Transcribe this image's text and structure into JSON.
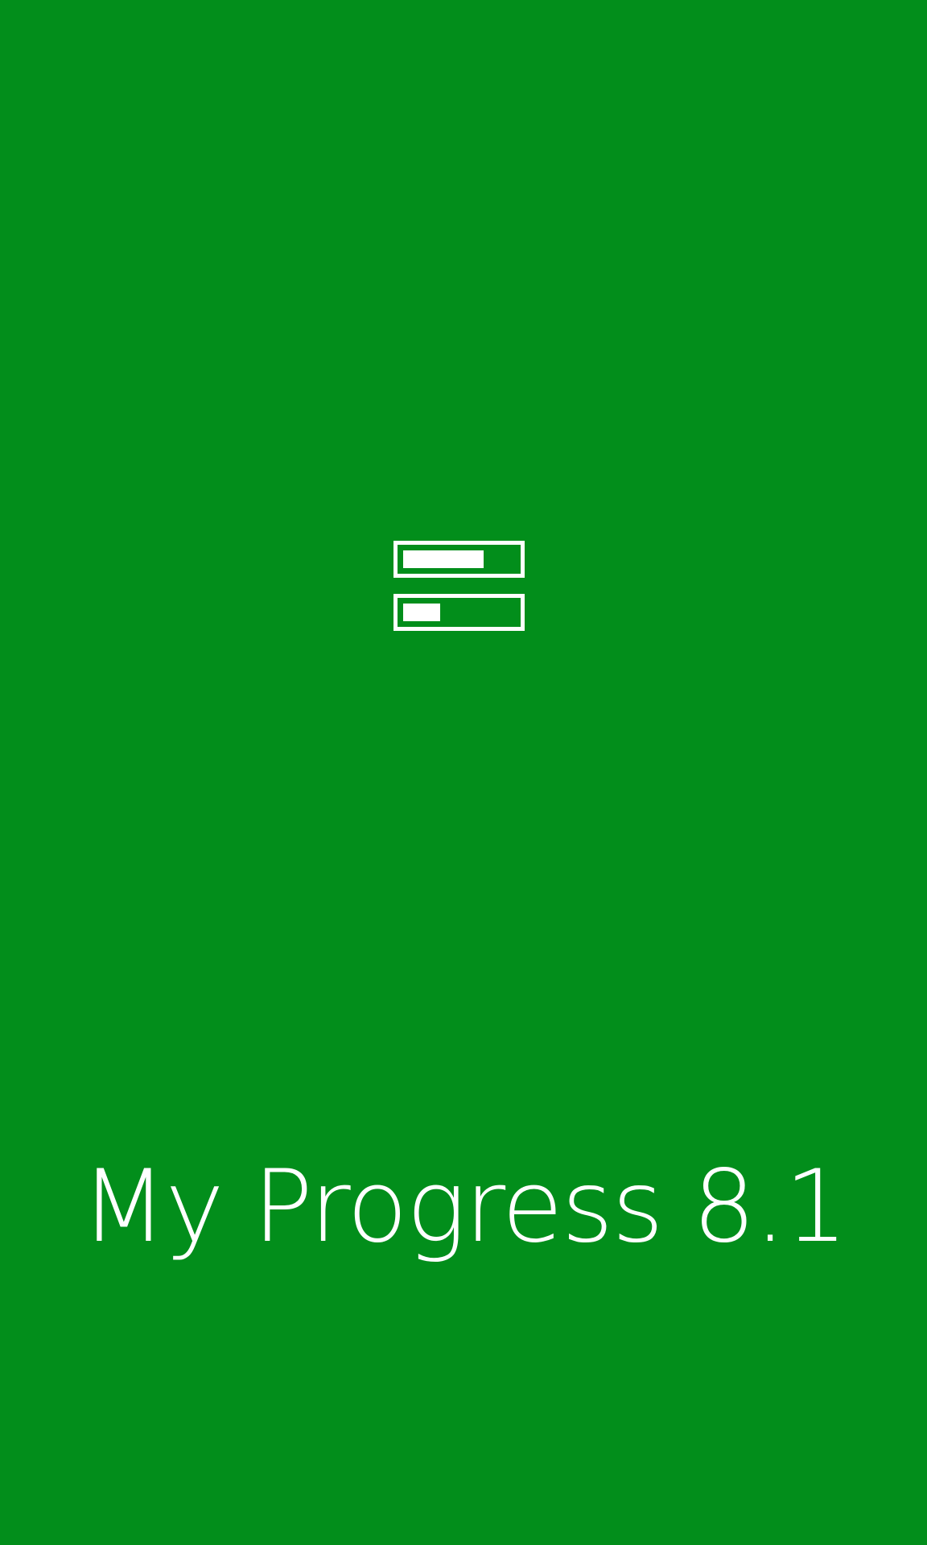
{
  "app": {
    "title": "My Progress 8.1",
    "background_color": "#028e1b",
    "foreground_color": "#ffffff",
    "logo_icon": "progress-bars-icon",
    "logo_bars": [
      {
        "fill_fraction": 0.72
      },
      {
        "fill_fraction": 0.33
      }
    ]
  }
}
